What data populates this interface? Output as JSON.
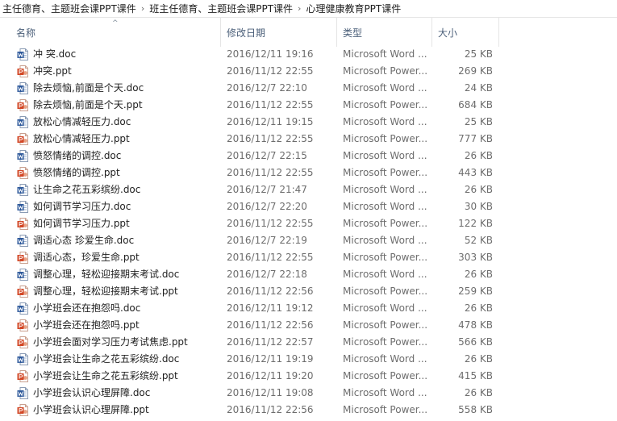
{
  "breadcrumb": {
    "items": [
      "主任德育、主题班会课PPT课件",
      "班主任德育、主题班会课PPT课件",
      "心理健康教育PPT课件"
    ],
    "separator": "›"
  },
  "columns": {
    "name": "名称",
    "date": "修改日期",
    "type": "类型",
    "size": "大小",
    "sort_indicator": "^"
  },
  "icons": {
    "doc": "word-document-icon",
    "ppt": "powerpoint-document-icon"
  },
  "colors": {
    "word_blue": "#2b579a",
    "ppt_orange": "#d24726",
    "header_text": "#4c607a",
    "detail_text": "#6d6d6d"
  },
  "files": [
    {
      "name": "冲 突.doc",
      "date": "2016/12/11 19:16",
      "type": "Microsoft Word ...",
      "size": "25 KB",
      "kind": "doc"
    },
    {
      "name": "冲突.ppt",
      "date": "2016/11/12 22:55",
      "type": "Microsoft Power...",
      "size": "269 KB",
      "kind": "ppt"
    },
    {
      "name": "除去烦恼,前面是个天.doc",
      "date": "2016/12/7 22:10",
      "type": "Microsoft Word ...",
      "size": "24 KB",
      "kind": "doc"
    },
    {
      "name": "除去烦恼,前面是个天.ppt",
      "date": "2016/11/12 22:55",
      "type": "Microsoft Power...",
      "size": "684 KB",
      "kind": "ppt"
    },
    {
      "name": "放松心情减轻压力.doc",
      "date": "2016/12/11 19:15",
      "type": "Microsoft Word ...",
      "size": "25 KB",
      "kind": "doc"
    },
    {
      "name": "放松心情减轻压力.ppt",
      "date": "2016/11/12 22:55",
      "type": "Microsoft Power...",
      "size": "777 KB",
      "kind": "ppt"
    },
    {
      "name": "愤怒情绪的调控.doc",
      "date": "2016/12/7 22:15",
      "type": "Microsoft Word ...",
      "size": "26 KB",
      "kind": "doc"
    },
    {
      "name": "愤怒情绪的调控.ppt",
      "date": "2016/11/12 22:55",
      "type": "Microsoft Power...",
      "size": "443 KB",
      "kind": "ppt"
    },
    {
      "name": "让生命之花五彩缤纷.doc",
      "date": "2016/12/7 21:47",
      "type": "Microsoft Word ...",
      "size": "26 KB",
      "kind": "doc"
    },
    {
      "name": "如何调节学习压力.doc",
      "date": "2016/12/7 22:20",
      "type": "Microsoft Word ...",
      "size": "30 KB",
      "kind": "doc"
    },
    {
      "name": "如何调节学习压力.ppt",
      "date": "2016/11/12 22:55",
      "type": "Microsoft Power...",
      "size": "122 KB",
      "kind": "ppt"
    },
    {
      "name": "调适心态 珍爱生命.doc",
      "date": "2016/12/7 22:19",
      "type": "Microsoft Word ...",
      "size": "52 KB",
      "kind": "doc"
    },
    {
      "name": "调适心态，珍爱生命.ppt",
      "date": "2016/11/12 22:55",
      "type": "Microsoft Power...",
      "size": "303 KB",
      "kind": "ppt"
    },
    {
      "name": "调整心理，轻松迎接期末考试.doc",
      "date": "2016/12/7 22:18",
      "type": "Microsoft Word ...",
      "size": "26 KB",
      "kind": "doc"
    },
    {
      "name": "调整心理，轻松迎接期末考试.ppt",
      "date": "2016/11/12 22:56",
      "type": "Microsoft Power...",
      "size": "259 KB",
      "kind": "ppt"
    },
    {
      "name": "小学班会还在抱怨吗.doc",
      "date": "2016/12/11 19:12",
      "type": "Microsoft Word ...",
      "size": "26 KB",
      "kind": "doc"
    },
    {
      "name": "小学班会还在抱怨吗.ppt",
      "date": "2016/11/12 22:56",
      "type": "Microsoft Power...",
      "size": "478 KB",
      "kind": "ppt"
    },
    {
      "name": "小学班会面对学习压力考试焦虑.ppt",
      "date": "2016/11/12 22:57",
      "type": "Microsoft Power...",
      "size": "566 KB",
      "kind": "ppt"
    },
    {
      "name": "小学班会让生命之花五彩缤纷.doc",
      "date": "2016/12/11 19:19",
      "type": "Microsoft Word ...",
      "size": "26 KB",
      "kind": "doc"
    },
    {
      "name": "小学班会让生命之花五彩缤纷.ppt",
      "date": "2016/12/11 19:20",
      "type": "Microsoft Power...",
      "size": "415 KB",
      "kind": "ppt"
    },
    {
      "name": "小学班会认识心理屏障.doc",
      "date": "2016/12/11 19:08",
      "type": "Microsoft Word ...",
      "size": "26 KB",
      "kind": "doc"
    },
    {
      "name": "小学班会认识心理屏障.ppt",
      "date": "2016/11/12 22:56",
      "type": "Microsoft Power...",
      "size": "558 KB",
      "kind": "ppt"
    }
  ]
}
